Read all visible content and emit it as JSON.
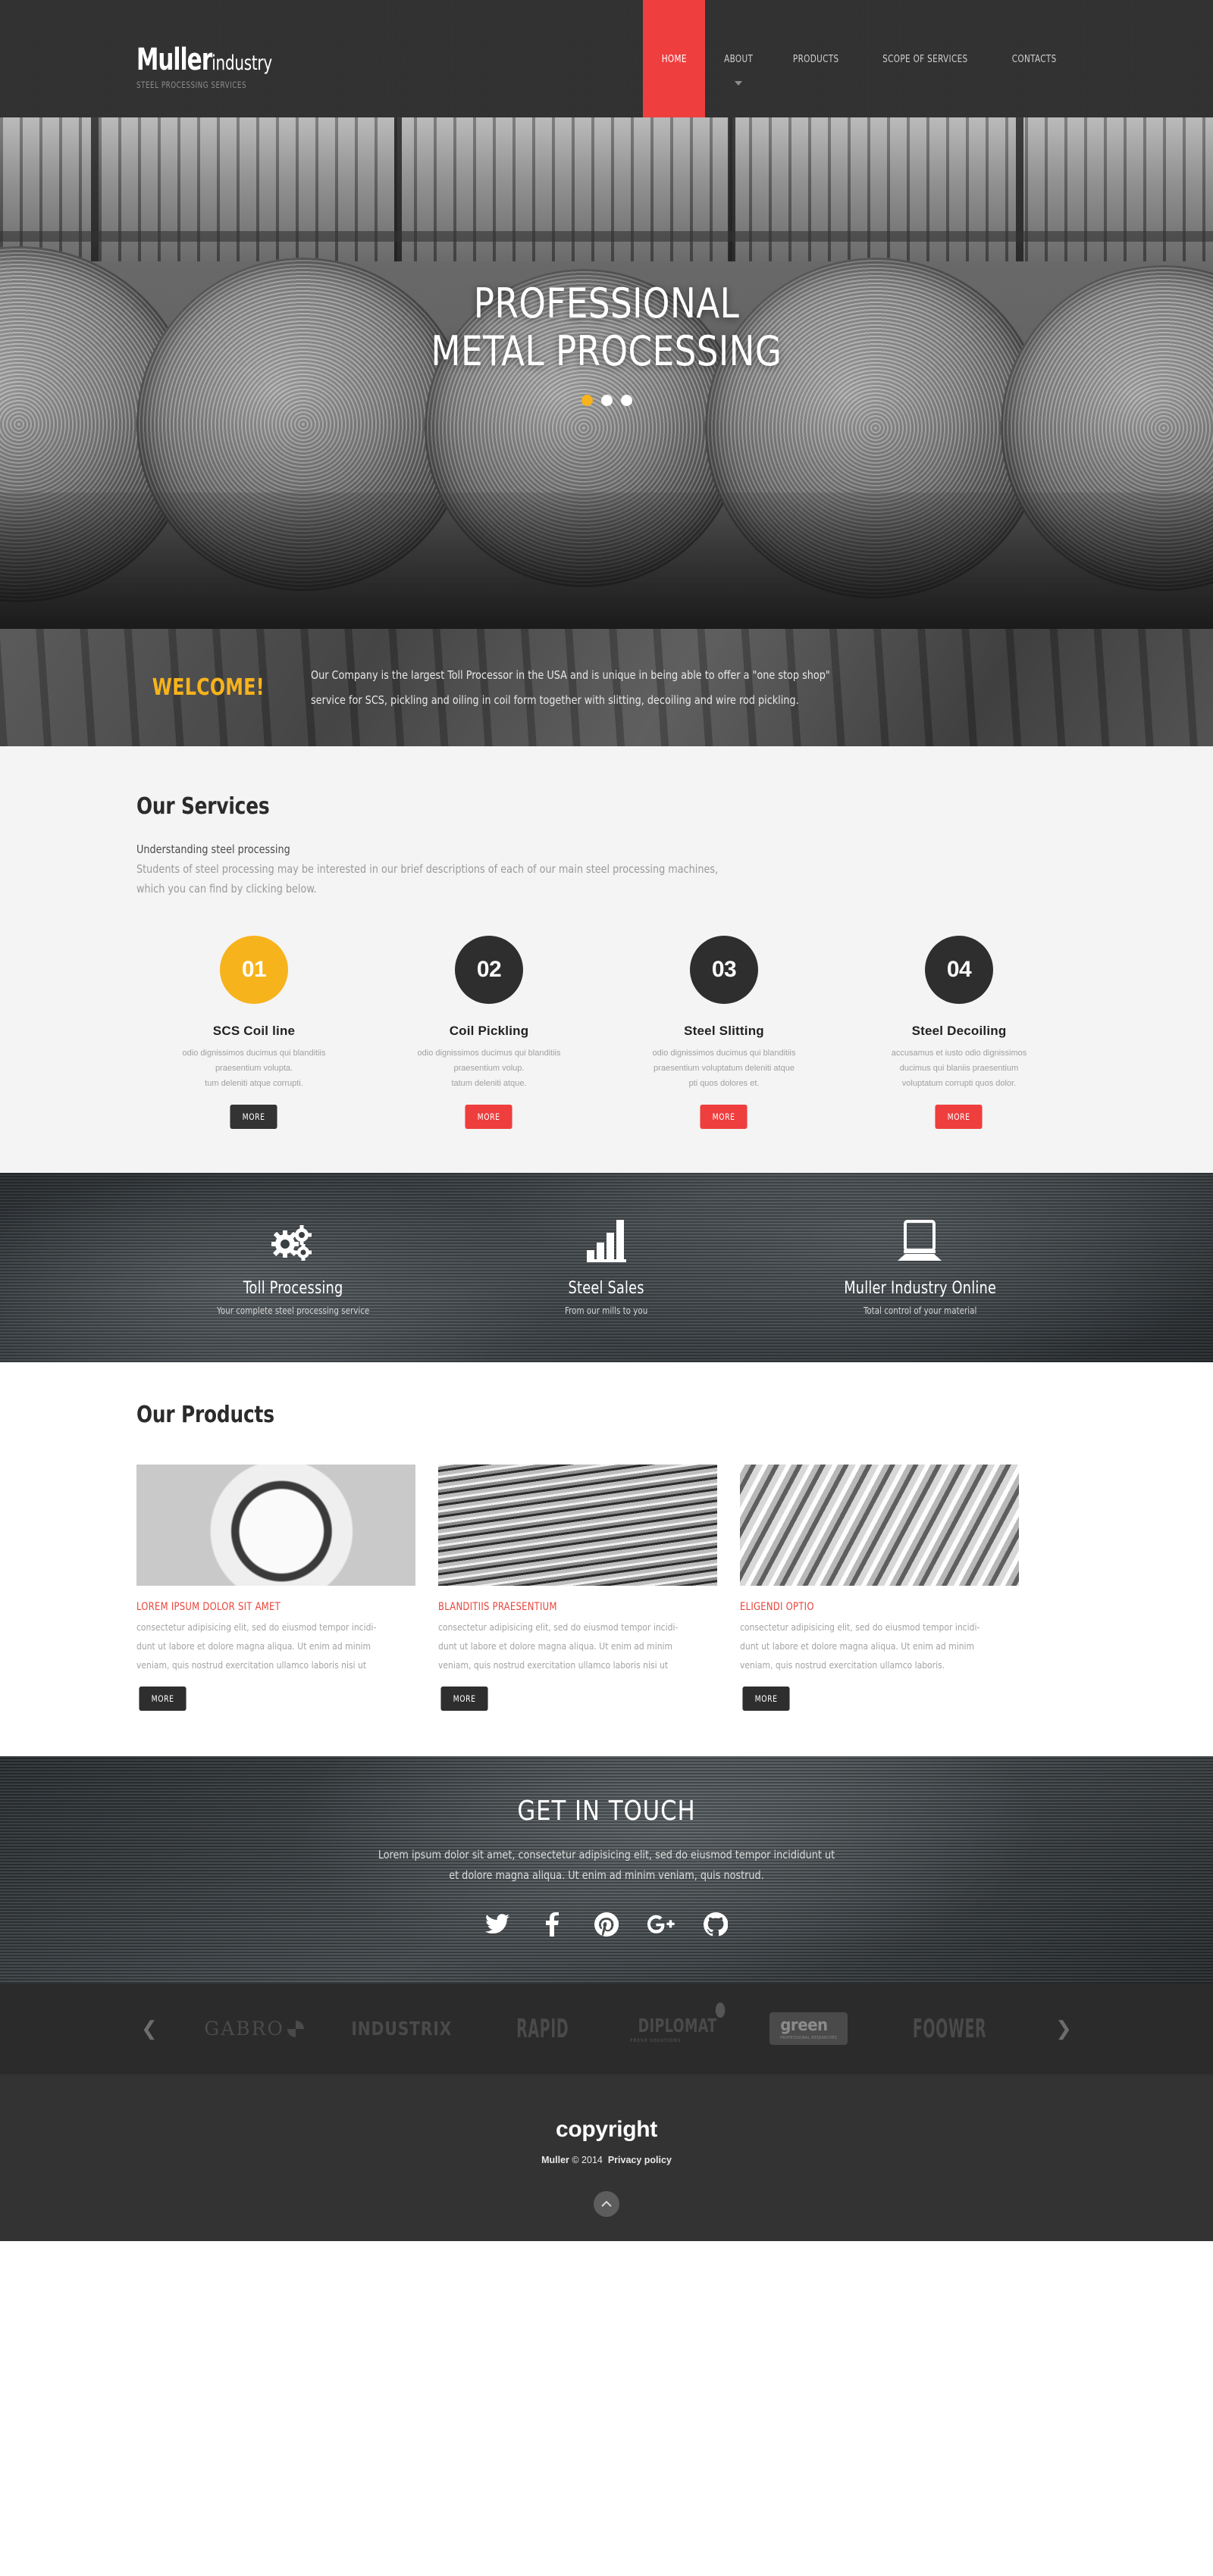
{
  "header": {
    "logo_main": "Muller",
    "logo_sub": "industry",
    "logo_tagline": "STEEL PROCESSING SERVICES",
    "nav": [
      {
        "label": "HOME",
        "active": true,
        "caret": false
      },
      {
        "label": "ABOUT",
        "active": false,
        "caret": true
      },
      {
        "label": "PRODUCTS",
        "active": false,
        "caret": false
      },
      {
        "label": "SCOPE OF SERVICES",
        "active": false,
        "caret": false
      },
      {
        "label": "CONTACTS",
        "active": false,
        "caret": false
      }
    ],
    "accent_color": "#ef3e3e"
  },
  "hero": {
    "title_line1": "PROFESSIONAL",
    "title_line2": "METAL PROCESSING",
    "slides": 3,
    "active_slide": 1,
    "active_dot_color": "#f7b31b"
  },
  "welcome": {
    "title": "WELCOME!",
    "title_color": "#f7b31b",
    "line1": "Our Company is the largest Toll Processor in the USA and is unique in being able to offer a \"one stop shop\"",
    "line2": "service for SCS, pickling and oiling in coil form together with slitting, decoiling and wire rod pickling."
  },
  "services": {
    "title": "Our Services",
    "subtitle": "Understanding steel processing",
    "description_line1": "Students of steel processing may be interested in our brief descriptions of each of our main steel processing machines,",
    "description_line2": "which you can find by clicking below.",
    "cards": [
      {
        "number": "01",
        "title": "SCS Coil line",
        "text_line1": "odio dignissimos ducimus qui blanditiis",
        "text_line2": "praesentium volupta.",
        "text_line3": "tum deleniti atque corrupti.",
        "button": "MORE",
        "badge_color": "#f7b31b",
        "button_color": "#333333",
        "highlighted": true
      },
      {
        "number": "02",
        "title": "Coil Pickling",
        "text_line1": "odio dignissimos ducimus qui blanditiis",
        "text_line2": "praesentium volup.",
        "text_line3": "tatum deleniti atque.",
        "button": "MORE",
        "badge_color": "#2e2e2e",
        "button_color": "#ef3e3e",
        "highlighted": false
      },
      {
        "number": "03",
        "title": "Steel Slitting",
        "text_line1": "odio dignissimos ducimus qui blanditiis",
        "text_line2": "praesentium voluptatum deleniti atque",
        "text_line3": "pti quos dolores et.",
        "button": "MORE",
        "badge_color": "#2e2e2e",
        "button_color": "#ef3e3e",
        "highlighted": false
      },
      {
        "number": "04",
        "title": "Steel Decoiling",
        "text_line1": "accusamus et iusto odio dignissimos",
        "text_line2": "ducimus qui blaniis praesentium",
        "text_line3": "voluptatum corrupti quos dolor.",
        "button": "MORE",
        "badge_color": "#2e2e2e",
        "button_color": "#ef3e3e",
        "highlighted": false
      }
    ]
  },
  "features": [
    {
      "icon": "gears-icon",
      "title": "Toll Processing",
      "subtitle": "Your complete steel processing service"
    },
    {
      "icon": "bar-chart-icon",
      "title": "Steel Sales",
      "subtitle": "From our mills to you"
    },
    {
      "icon": "laptop-icon",
      "title": "Muller Industry Online",
      "subtitle": "Total control of your material"
    }
  ],
  "products": {
    "title": "Our Products",
    "items": [
      {
        "image": "gears-photo",
        "title": "LOREM IPSUM DOLOR SIT AMET",
        "text_line1": "consectetur adipisicing elit, sed do eiusmod tempor incidi-",
        "text_line2": "dunt ut labore et dolore magna aliqua. Ut enim ad minim",
        "text_line3": "veniam, quis nostrud exercitation ullamco laboris nisi ut",
        "button": "MORE"
      },
      {
        "image": "wire-photo",
        "title": "BLANDITIIS PRAESENTIUM",
        "text_line1": "consectetur adipisicing elit, sed do eiusmod tempor incidi-",
        "text_line2": "dunt ut labore et dolore magna aliqua. Ut enim ad minim",
        "text_line3": "veniam, quis nostrud exercitation ullamco laboris nisi ut",
        "button": "MORE"
      },
      {
        "image": "tubes-photo",
        "title": "ELIGENDI OPTIO",
        "text_line1": "consectetur adipisicing elit, sed do eiusmod tempor incidi-",
        "text_line2": "dunt ut labore et dolore magna aliqua. Ut enim ad minim",
        "text_line3": "veniam, quis nostrud exercitation ullamco laboris.",
        "button": "MORE"
      }
    ],
    "title_color": "#e8453c"
  },
  "touch": {
    "title": "GET IN TOUCH",
    "text_line1": "Lorem ipsum dolor sit amet, consectetur adipisicing elit, sed do eiusmod tempor incididunt ut",
    "text_line2": "et dolore magna aliqua. Ut enim ad minim veniam, quis nostrud.",
    "socials": [
      "twitter-icon",
      "facebook-icon",
      "pinterest-icon",
      "google-plus-icon",
      "github-icon"
    ]
  },
  "brands": {
    "prev": "❮",
    "next": "❯",
    "items": [
      {
        "name": "GABRO"
      },
      {
        "name": "INDUSTRIX"
      },
      {
        "name": "RAPID"
      },
      {
        "name": "DIPLOMAT",
        "sub": "FRESH SOLUTIONS"
      },
      {
        "name": "green",
        "sub": "PROFESSIONAL RESEARCHES"
      },
      {
        "name": "FOOWER"
      }
    ]
  },
  "footer": {
    "title": "copyright",
    "brand": "Muller",
    "copy": "© 2014",
    "privacy": "Privacy policy",
    "to_top_icon": "chevron-up-icon"
  }
}
